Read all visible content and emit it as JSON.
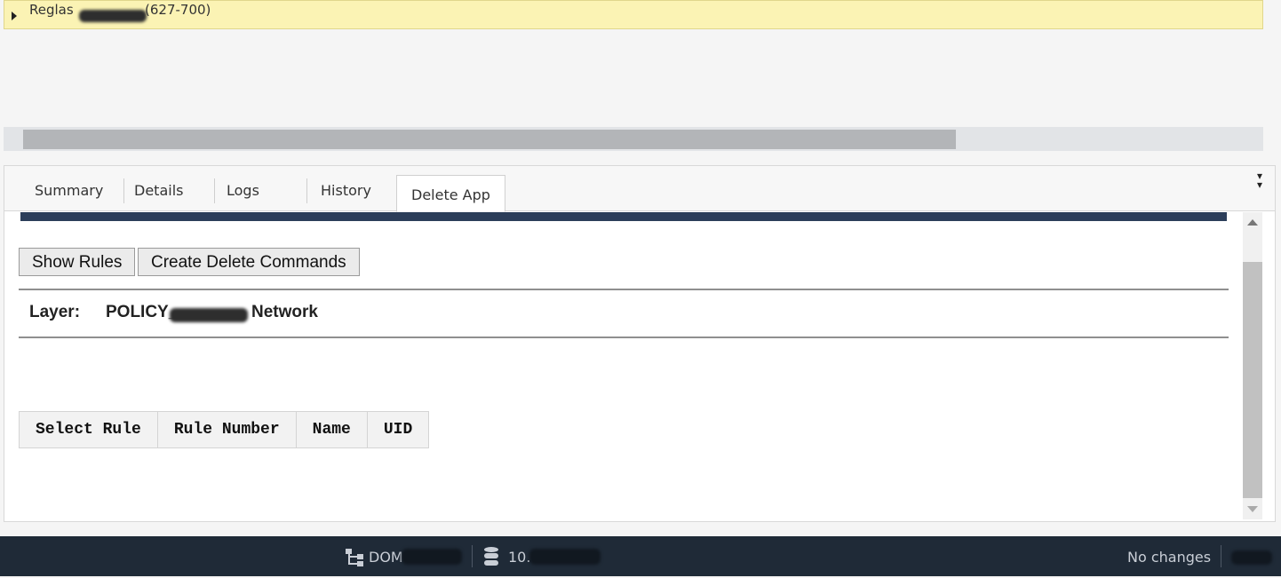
{
  "group_bar": {
    "prefix": "Reglas",
    "range": "(627-700)"
  },
  "tabs": [
    {
      "label": "Summary",
      "active": false
    },
    {
      "label": "Details",
      "active": false
    },
    {
      "label": "Logs",
      "active": false
    },
    {
      "label": "History",
      "active": false
    },
    {
      "label": "Delete App",
      "active": true
    }
  ],
  "actions": {
    "show_rules": "Show Rules",
    "create_delete_commands": "Create Delete Commands"
  },
  "layer": {
    "label": "Layer:",
    "value_prefix": "POLICY_",
    "value_suffix": "Network"
  },
  "table": {
    "columns": [
      "Select Rule",
      "Rule Number",
      "Name",
      "UID"
    ]
  },
  "statusbar": {
    "domain_prefix": "DOM",
    "server_prefix": "10.",
    "changes": "No changes"
  },
  "colors": {
    "group_bar_bg": "#fbf3b4",
    "statusbar_bg": "#1f2a37",
    "navy_strip": "#2c3e5a"
  }
}
